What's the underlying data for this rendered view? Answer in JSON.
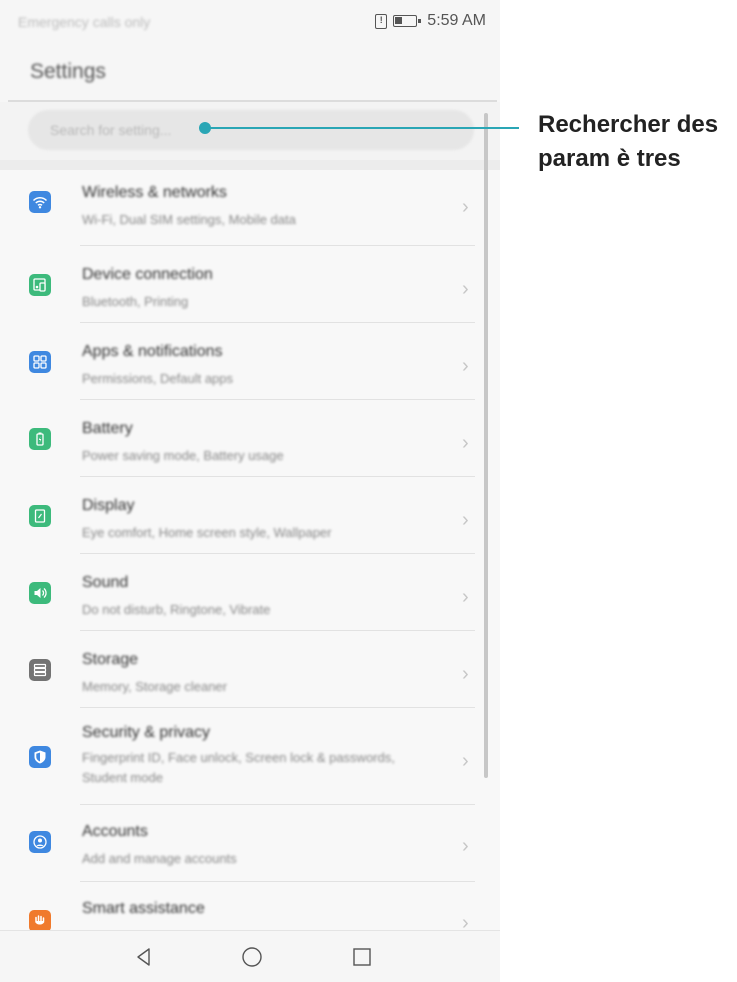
{
  "status_bar": {
    "carrier": "Emergency calls only",
    "time": "5:59 AM"
  },
  "header": {
    "title": "Settings"
  },
  "search": {
    "placeholder": "Search for setting..."
  },
  "settings_items": [
    {
      "title": "Wireless & networks",
      "subtitle": "Wi-Fi, Dual SIM settings, Mobile data",
      "icon": "wifi-icon",
      "color": "#3f88e0"
    },
    {
      "title": "Device connection",
      "subtitle": "Bluetooth, Printing",
      "icon": "device-connection-icon",
      "color": "#3dba7c"
    },
    {
      "title": "Apps & notifications",
      "subtitle": "Permissions, Default apps",
      "icon": "apps-icon",
      "color": "#3f88e0"
    },
    {
      "title": "Battery",
      "subtitle": "Power saving mode, Battery usage",
      "icon": "battery-icon",
      "color": "#3dba7c"
    },
    {
      "title": "Display",
      "subtitle": "Eye comfort, Home screen style, Wallpaper",
      "icon": "display-icon",
      "color": "#3dba7c"
    },
    {
      "title": "Sound",
      "subtitle": "Do not disturb, Ringtone, Vibrate",
      "icon": "sound-icon",
      "color": "#3dba7c"
    },
    {
      "title": "Storage",
      "subtitle": "Memory, Storage cleaner",
      "icon": "storage-icon",
      "color": "#737373"
    },
    {
      "title": "Security & privacy",
      "subtitle": "Fingerprint ID, Face unlock, Screen lock & passwords, Student mode",
      "icon": "shield-icon",
      "color": "#3f88e0"
    },
    {
      "title": "Accounts",
      "subtitle": "Add and manage accounts",
      "icon": "account-icon",
      "color": "#3f88e0"
    },
    {
      "title": "Smart assistance",
      "subtitle": "",
      "icon": "hand-icon",
      "color": "#f07a2c"
    }
  ],
  "annotation": {
    "label": "Rechercher des param è tres",
    "color": "#2aa6b5"
  }
}
